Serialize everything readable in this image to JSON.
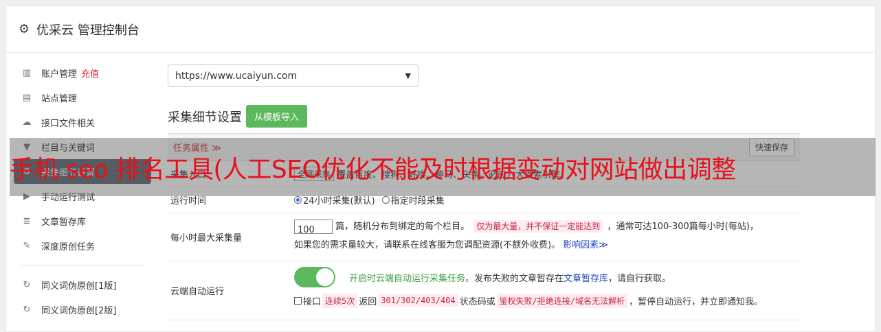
{
  "header": {
    "icon": "gear-icon",
    "title": "优采云 管理控制台"
  },
  "sidebar": {
    "items": [
      {
        "icon": "bar-chart-icon",
        "glyph": "▥",
        "label": "账户管理",
        "badge": "充值"
      },
      {
        "icon": "server-icon",
        "glyph": "▤",
        "label": "站点管理"
      },
      {
        "icon": "cloud-upload-icon",
        "glyph": "☁",
        "label": "接口文件相关"
      },
      {
        "icon": "filter-icon",
        "glyph": "▼",
        "label": "栏目与关键词"
      },
      {
        "icon": "cogs-icon",
        "glyph": "⚙",
        "label": "采集细节设置",
        "active": true
      },
      {
        "icon": "play-circle-icon",
        "glyph": "▶",
        "label": "手动运行测试"
      },
      {
        "icon": "database-icon",
        "glyph": "≣",
        "label": "文章暂存库"
      },
      {
        "icon": "edit-icon",
        "glyph": "✎",
        "label": "深度原创任务"
      }
    ],
    "items2": [
      {
        "icon": "refresh-icon",
        "glyph": "↻",
        "label": "同义词伪原创[1版]"
      },
      {
        "icon": "refresh-icon",
        "glyph": "↻",
        "label": "同义词伪原创[2版]"
      }
    ]
  },
  "site_select": {
    "value": "https://www.ucaiyun.com"
  },
  "section": {
    "title": "采集细节设置",
    "import_button": "从模板导入"
  },
  "table": {
    "header_label": "任务属性 ≫",
    "quick_save": "快速保存",
    "rows": {
      "entry": {
        "label": "采集入口",
        "select": "全网采集",
        "desc": "覆盖百度、搜狗、好搜、神马、头条、必应六大搜索引擎。"
      },
      "runtime": {
        "label": "运行时间",
        "opt1": "24小时采集(默认)",
        "opt2": "指定时段采集"
      },
      "max_per_hour": {
        "label": "每小时最大采集量",
        "value": "100",
        "text1": "篇，随机分布到绑定的每个栏目。",
        "tag1": "仅为最大量，并不保证一定能达到",
        "text2": "，通常可达100-300篇每小时(每站)，",
        "text3": "如果您的需求量较大，请联系在线客服为您调配资源(不额外收费)。",
        "link": "影响因素≫"
      },
      "cloud": {
        "label": "云端自动运行",
        "green_text": "开启时云端自动运行采集任务。",
        "text1": "发布失败的文章暂存在",
        "link": "文章暂存库",
        "text2": "，请自行获取。",
        "chk_label": "接口",
        "tag1": "连续5次",
        "text3": "返回",
        "tag2": "301/302/403/404",
        "text4": "状态码或",
        "tag3": "鉴权失败/拒绝连接/域名无法解析",
        "text5": "，暂停自动运行，并立即通知我。",
        "toggle_on": true
      }
    }
  },
  "banner": {
    "text": "手机 seo 排名工具(人工SEO优化不能及时根据变动对网站做出调整"
  },
  "colors": {
    "accent_green": "#5cb85c",
    "active_sidebar": "#5a6470",
    "banner_text": "#e8101a"
  }
}
